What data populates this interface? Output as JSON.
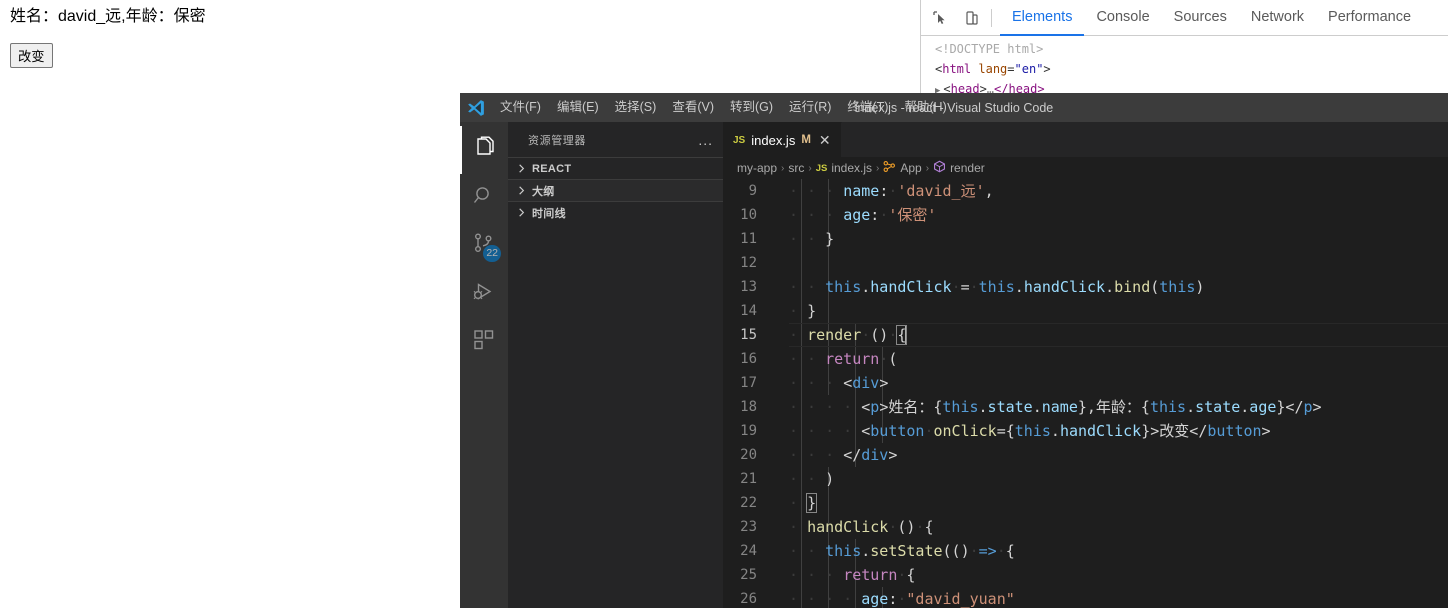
{
  "browser_page": {
    "text": "姓名：david_远,年龄：保密",
    "button_label": "改变"
  },
  "devtools": {
    "icons": [
      "inspect-element-icon",
      "device-toolbar-icon"
    ],
    "tabs": [
      {
        "label": "Elements",
        "active": true
      },
      {
        "label": "Console",
        "active": false
      },
      {
        "label": "Sources",
        "active": false
      },
      {
        "label": "Network",
        "active": false
      },
      {
        "label": "Performance",
        "active": false
      }
    ],
    "dom": {
      "line1": "<!DOCTYPE html>",
      "line2_open": "<",
      "line2_tag": "html",
      "line2_attr": "lang",
      "line2_eq": "=",
      "line2_val": "\"en\"",
      "line2_close": ">",
      "line3_open": "<",
      "line3_tag": "head",
      "line3_gt": ">",
      "line3_ellipsis": "…",
      "line3_closetag": "</head>"
    }
  },
  "vscode": {
    "window_title": "index.js - react - Visual Studio Code",
    "menu": [
      {
        "label": "文件(F)"
      },
      {
        "label": "编辑(E)"
      },
      {
        "label": "选择(S)"
      },
      {
        "label": "查看(V)"
      },
      {
        "label": "转到(G)"
      },
      {
        "label": "运行(R)"
      },
      {
        "label": "终端(T)"
      },
      {
        "label": "帮助(H)"
      }
    ],
    "activity_bar": [
      {
        "name": "explorer",
        "icon": "files-icon",
        "active": true,
        "badge": ""
      },
      {
        "name": "search",
        "icon": "search-icon",
        "active": false,
        "badge": ""
      },
      {
        "name": "source-control",
        "icon": "source-control-icon",
        "active": false,
        "badge": "22"
      },
      {
        "name": "run-debug",
        "icon": "run-and-debug-icon",
        "active": false,
        "badge": ""
      },
      {
        "name": "extensions",
        "icon": "extensions-icon",
        "active": false,
        "badge": ""
      }
    ],
    "sidebar": {
      "title": "资源管理器",
      "more_label": "...",
      "sections": [
        {
          "label": "REACT",
          "expanded": false
        },
        {
          "label": "大纲",
          "expanded": false
        },
        {
          "label": "时间线",
          "expanded": false
        }
      ]
    },
    "tab": {
      "file_badge": "JS",
      "file_name": "index.js",
      "dirty_marker": "M",
      "close_marker": "✕"
    },
    "breadcrumb": [
      {
        "label": "my-app",
        "icon": ""
      },
      {
        "label": "src",
        "icon": ""
      },
      {
        "label": "index.js",
        "icon": "js-icon"
      },
      {
        "label": "App",
        "icon": "class-icon"
      },
      {
        "label": "render",
        "icon": "method-icon"
      }
    ],
    "breadcrumb_separator": "›",
    "code": {
      "line_numbers": [
        "9",
        "10",
        "11",
        "12",
        "13",
        "14",
        "15",
        "16",
        "17",
        "18",
        "19",
        "20",
        "21",
        "22",
        "23",
        "24",
        "25",
        "26"
      ],
      "current_line": 15,
      "lines": [
        {
          "num": "9",
          "text": "      name: 'david_远',"
        },
        {
          "num": "10",
          "text": "      age: '保密'"
        },
        {
          "num": "11",
          "text": "    }"
        },
        {
          "num": "12",
          "text": ""
        },
        {
          "num": "13",
          "text": "    this.handClick = this.handClick.bind(this)"
        },
        {
          "num": "14",
          "text": "  }"
        },
        {
          "num": "15",
          "text": "  render () {"
        },
        {
          "num": "16",
          "text": "    return ("
        },
        {
          "num": "17",
          "text": "      <div>"
        },
        {
          "num": "18",
          "text": "        <p>姓名：{this.state.name},年龄：{this.state.age}</p>"
        },
        {
          "num": "19",
          "text": "        <button onClick={this.handClick}>改变</button>"
        },
        {
          "num": "20",
          "text": "      </div>"
        },
        {
          "num": "21",
          "text": "    )"
        },
        {
          "num": "22",
          "text": "  }"
        },
        {
          "num": "23",
          "text": "  handClick () {"
        },
        {
          "num": "24",
          "text": "    this.setState(() => {"
        },
        {
          "num": "25",
          "text": "      return {"
        },
        {
          "num": "26",
          "text": "        age: \"david_yuan\""
        }
      ]
    }
  },
  "colors": {
    "accent_blue": "#007acc",
    "devtools_active": "#1a73e8",
    "editor_bg": "#1e1e1e",
    "sidebar_bg": "#252526",
    "activitybar_bg": "#333333",
    "titlebar_bg": "#3c3c3c",
    "string_orange": "#ce9178",
    "keyword_blue": "#569cd6",
    "property_lightblue": "#9cdcfe",
    "function_yellow": "#dcdcaa",
    "gutter_bar_blue": "#0c7fc4"
  }
}
